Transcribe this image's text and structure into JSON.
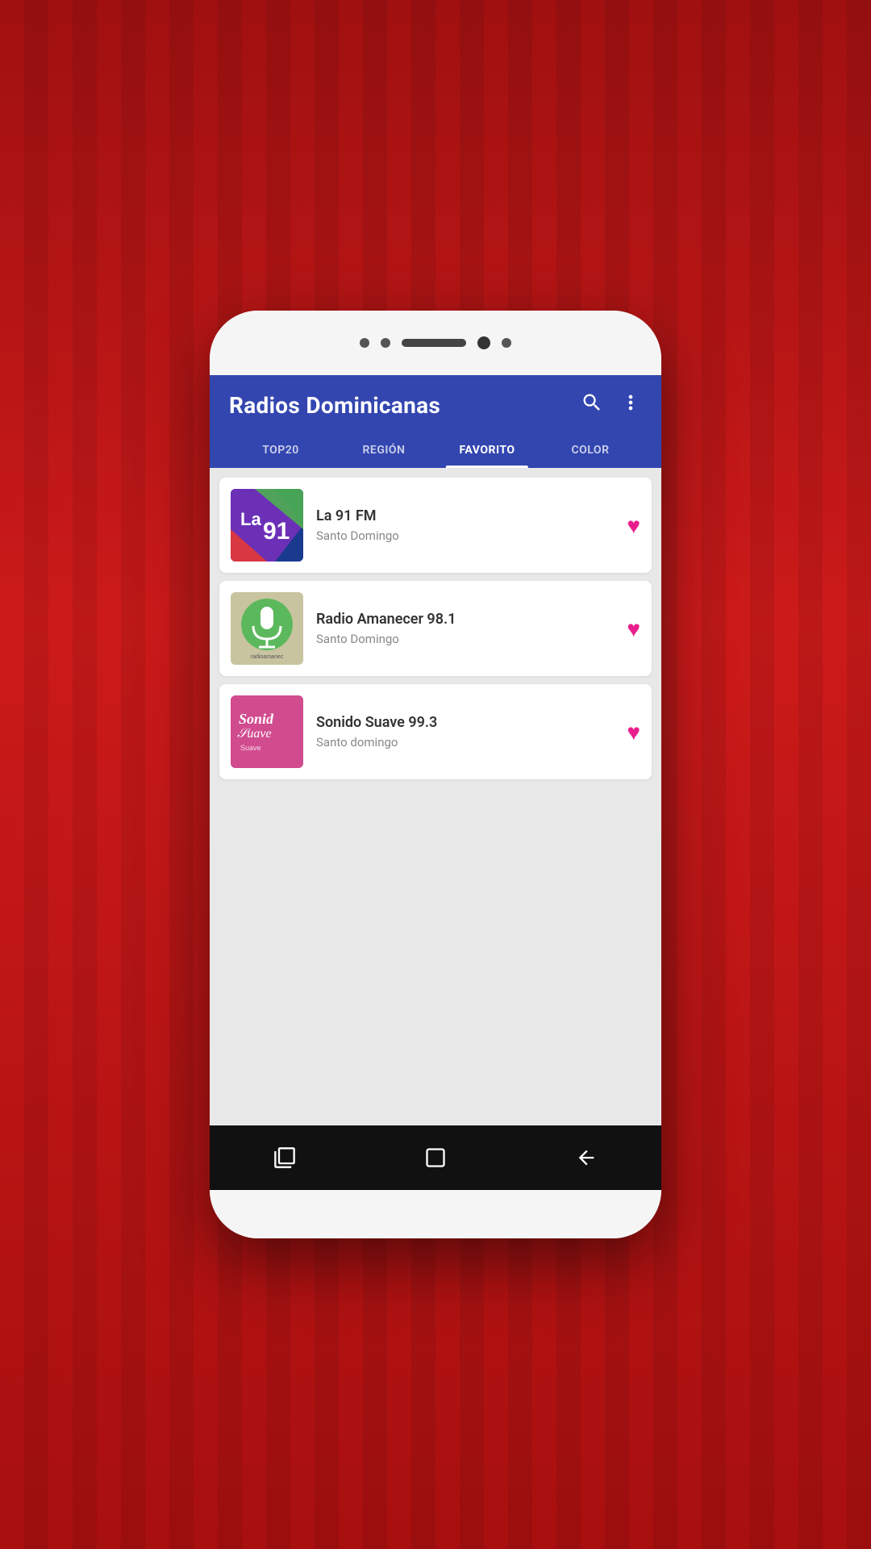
{
  "app": {
    "title": "Radios Dominicanas",
    "header_bg": "#3346b0"
  },
  "tabs": [
    {
      "id": "top20",
      "label": "TOP20",
      "active": false
    },
    {
      "id": "region",
      "label": "REGIÓN",
      "active": false
    },
    {
      "id": "favorito",
      "label": "FAVORITO",
      "active": true
    },
    {
      "id": "color",
      "label": "COLOR",
      "active": false
    }
  ],
  "stations": [
    {
      "id": "la91fm",
      "name": "La 91 FM",
      "location": "Santo Domingo",
      "favorited": true
    },
    {
      "id": "amanecer",
      "name": "Radio Amanecer 98.1",
      "location": "Santo Domingo",
      "favorited": true
    },
    {
      "id": "sonido",
      "name": "Sonido Suave 99.3",
      "location": "Santo domingo",
      "favorited": true
    }
  ],
  "nav": {
    "recent_icon": "⌐",
    "home_icon": "□",
    "back_icon": "←"
  }
}
